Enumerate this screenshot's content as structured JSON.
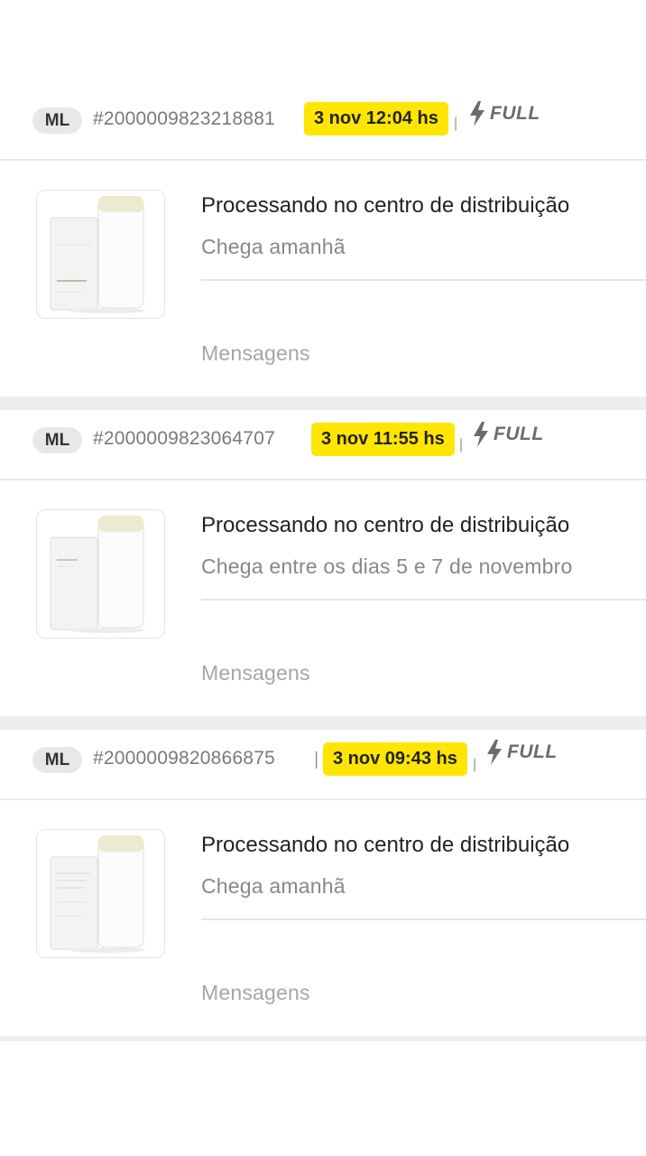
{
  "orders": [
    {
      "store_badge": "ML",
      "order_id": "#2000009823218881",
      "separator": "|",
      "date": "3 nov 12:04 hs",
      "shipping_tag": "FULL",
      "status": "Processando no centro de distribuição",
      "eta": "Chega amanhã",
      "messages_label": "Mensagens"
    },
    {
      "store_badge": "ML",
      "order_id": "#2000009823064707",
      "separator": "|",
      "date": "3 nov 11:55 hs",
      "shipping_tag": "FULL",
      "status": "Processando no centro de distribuição",
      "eta": "Chega entre os dias 5 e 7 de novembro",
      "messages_label": "Mensagens"
    },
    {
      "store_badge": "ML",
      "order_id": "#2000009820866875",
      "separator": "|",
      "date": "3 nov 09:43 hs",
      "shipping_tag": "FULL",
      "status": "Processando no centro de distribuição",
      "eta": "Chega amanhã",
      "messages_label": "Mensagens"
    }
  ],
  "colors": {
    "highlight": "#ffe600",
    "badge_bg": "#e8e8e8",
    "muted_text": "#888888",
    "separator_band": "#eeeeee"
  },
  "icons": {
    "shipping": "lightning-bolt-icon",
    "product": "product-thumbnail"
  }
}
